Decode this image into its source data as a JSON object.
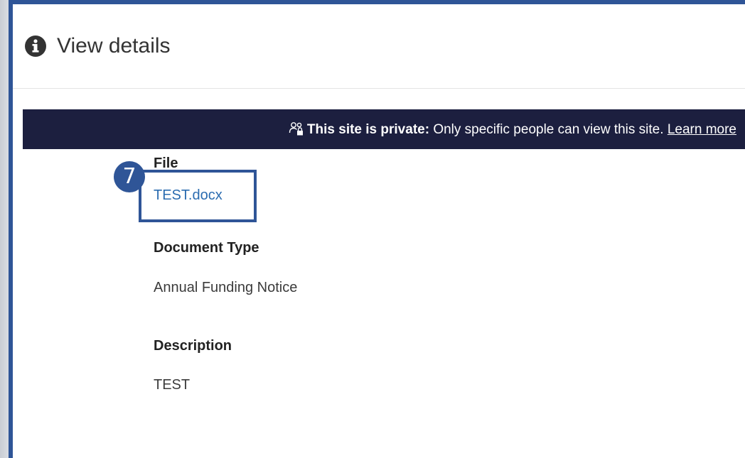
{
  "dialog": {
    "title": "View details",
    "title_icon": "info-circle-icon"
  },
  "banner": {
    "icon": "people-lock-icon",
    "strong_text": "This site is private:",
    "text": " Only specific people can view this site.",
    "link_text": "Learn more"
  },
  "details": {
    "file_label": "File",
    "file_value": "TEST.docx",
    "doctype_label": "Document Type",
    "doctype_value": "Annual Funding Notice",
    "description_label": "Description",
    "description_value": "TEST"
  },
  "annotation": {
    "step_number": "7"
  },
  "colors": {
    "accent": "#2f5597",
    "banner_bg": "#1c1f3f",
    "link": "#2b6cb0"
  }
}
